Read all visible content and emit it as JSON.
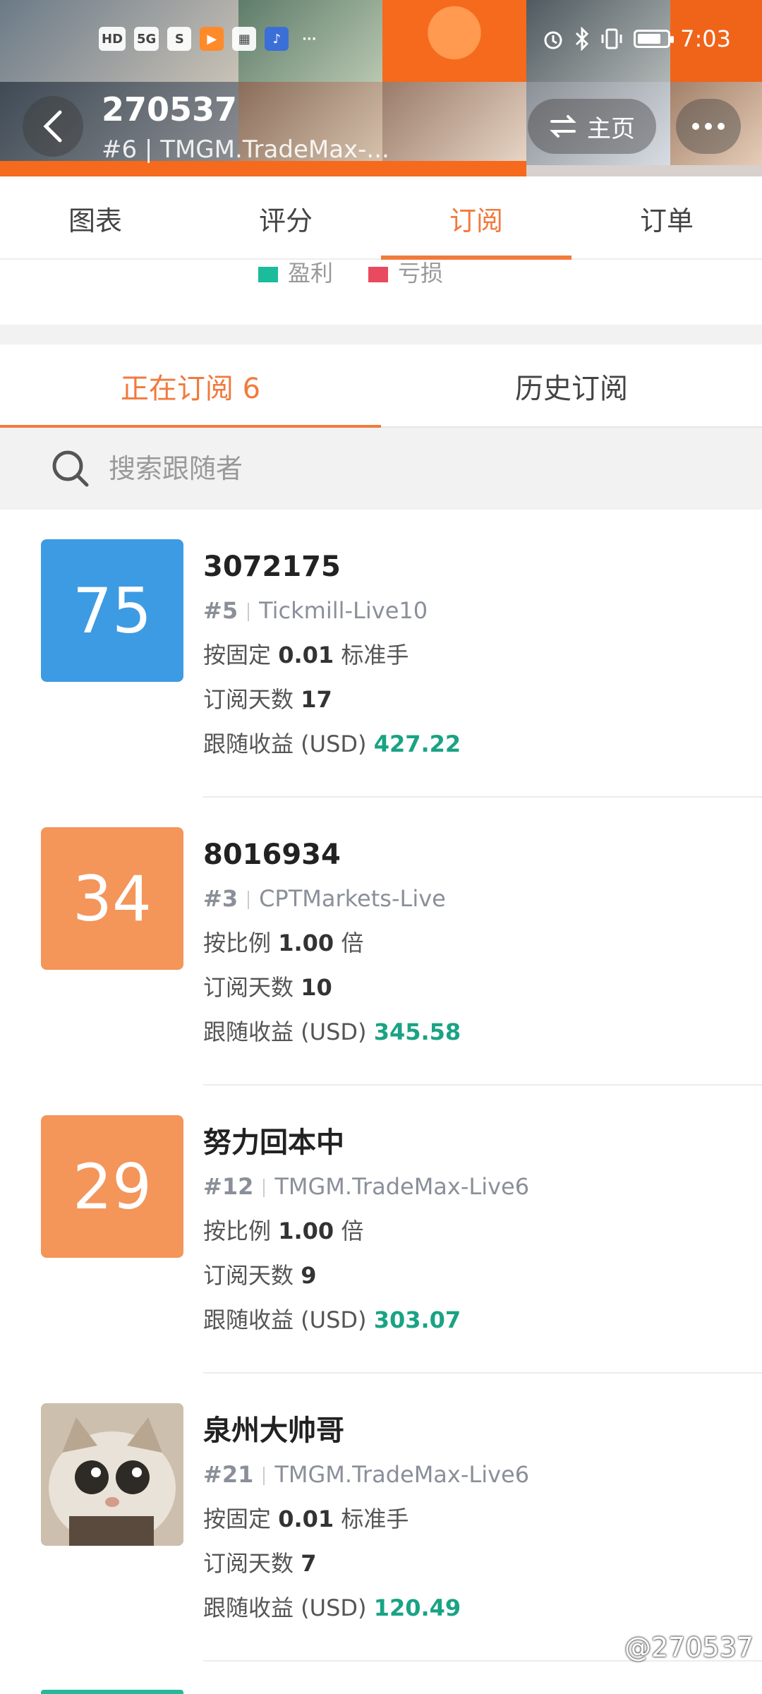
{
  "status_bar": {
    "chips": [
      "HD",
      "5G",
      "S",
      "▶",
      "▦",
      "♪",
      "···"
    ],
    "time": "7:03"
  },
  "header": {
    "title": "270537",
    "subtitle": "#6 | TMGM.TradeMax-...",
    "home_label": "主页"
  },
  "main_tabs": [
    {
      "label": "图表"
    },
    {
      "label": "评分"
    },
    {
      "label": "订阅"
    },
    {
      "label": "订单"
    }
  ],
  "legend": {
    "profit_label": "盈利",
    "loss_label": "亏损",
    "profit_color": "#1abc9c",
    "loss_color": "#e84a5f"
  },
  "sub_tabs": [
    {
      "label": "正在订阅 6"
    },
    {
      "label": "历史订阅"
    }
  ],
  "search": {
    "placeholder": "搜索跟随者"
  },
  "subscriptions": [
    {
      "avatar_text": "75",
      "avatar_color": "#3d9be3",
      "name": "3072175",
      "rank": "#5",
      "broker": "Tickmill-Live10",
      "mode_prefix": "按固定",
      "mode_value": "0.01",
      "mode_suffix": "标准手",
      "days_label": "订阅天数",
      "days": "17",
      "profit_label": "跟随收益 (USD)",
      "profit": "427.22"
    },
    {
      "avatar_text": "34",
      "avatar_color": "#f4955a",
      "name": "8016934",
      "rank": "#3",
      "broker": "CPTMarkets-Live",
      "mode_prefix": "按比例",
      "mode_value": "1.00",
      "mode_suffix": "倍",
      "days_label": "订阅天数",
      "days": "10",
      "profit_label": "跟随收益 (USD)",
      "profit": "345.58"
    },
    {
      "avatar_text": "29",
      "avatar_color": "#f4955a",
      "name": "努力回本中",
      "rank": "#12",
      "broker": "TMGM.TradeMax-Live6",
      "mode_prefix": "按比例",
      "mode_value": "1.00",
      "mode_suffix": "倍",
      "days_label": "订阅天数",
      "days": "9",
      "profit_label": "跟随收益 (USD)",
      "profit": "303.07"
    },
    {
      "avatar_text": "",
      "avatar_color": "#b9a58e",
      "name": "泉州大帅哥",
      "rank": "#21",
      "broker": "TMGM.TradeMax-Live6",
      "mode_prefix": "按固定",
      "mode_value": "0.01",
      "mode_suffix": "标准手",
      "days_label": "订阅天数",
      "days": "7",
      "profit_label": "跟随收益 (USD)",
      "profit": "120.49"
    }
  ],
  "watermark": "@270537",
  "colors": {
    "accent": "#f27a3c",
    "profit": "#1aa384"
  }
}
